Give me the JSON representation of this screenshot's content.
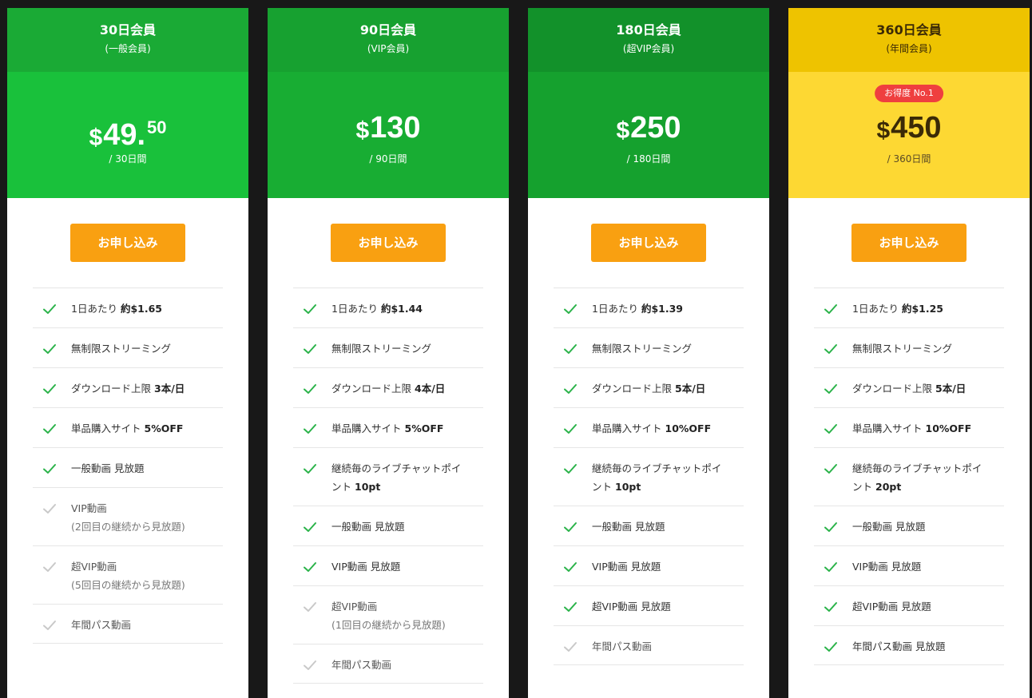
{
  "plans": [
    {
      "name": "30日会員",
      "subtitle": "(一般会員)",
      "price": {
        "currency": "$",
        "amount": "49.",
        "decimal": "50"
      },
      "period": "/ 30日間",
      "button": "お申し込み",
      "head_color": "#1aaa35",
      "price_color": "#19c13b",
      "features": [
        {
          "text": "1日あたり",
          "bold": "約$1.65",
          "included": true
        },
        {
          "text": "無制限ストリーミング",
          "included": true
        },
        {
          "text": "ダウンロード上限",
          "bold": "3本/日",
          "included": true
        },
        {
          "text": "単品購入サイト",
          "bold": "5%OFF",
          "included": true
        },
        {
          "text": "一般動画 見放題",
          "included": true
        },
        {
          "text": "VIP動画",
          "note": "(2回目の継続から見放題)",
          "included": false
        },
        {
          "text": "超VIP動画",
          "note": "(5回目の継続から見放題)",
          "included": false
        },
        {
          "text": "年間パス動画",
          "included": false
        }
      ]
    },
    {
      "name": "90日会員",
      "subtitle": "(VIP会員)",
      "price": {
        "currency": "$",
        "amount": "130"
      },
      "period": "/ 90日間",
      "button": "お申し込み",
      "head_color": "#17a130",
      "price_color": "#18ad33",
      "features": [
        {
          "text": "1日あたり",
          "bold": "約$1.44",
          "included": true
        },
        {
          "text": "無制限ストリーミング",
          "included": true
        },
        {
          "text": "ダウンロード上限",
          "bold": "4本/日",
          "included": true
        },
        {
          "text": "単品購入サイト",
          "bold": "5%OFF",
          "included": true
        },
        {
          "text": "継続毎のライブチャットポイ",
          "text2": "ント",
          "bold": "10pt",
          "included": true
        },
        {
          "text": "一般動画 見放題",
          "included": true
        },
        {
          "text": "VIP動画 見放題",
          "included": true
        },
        {
          "text": "超VIP動画",
          "note": "(1回目の継続から見放題)",
          "included": false
        },
        {
          "text": "年間パス動画",
          "included": false
        }
      ]
    },
    {
      "name": "180日会員",
      "subtitle": "(超VIP会員)",
      "price": {
        "currency": "$",
        "amount": "250"
      },
      "period": "/ 180日間",
      "button": "お申し込み",
      "head_color": "#12912a",
      "price_color": "#15a12e",
      "features": [
        {
          "text": "1日あたり",
          "bold": "約$1.39",
          "included": true
        },
        {
          "text": "無制限ストリーミング",
          "included": true
        },
        {
          "text": "ダウンロード上限",
          "bold": "5本/日",
          "included": true
        },
        {
          "text": "単品購入サイト",
          "bold": "10%OFF",
          "included": true
        },
        {
          "text": "継続毎のライブチャットポイ",
          "text2": "ント",
          "bold": "10pt",
          "included": true
        },
        {
          "text": "一般動画 見放題",
          "included": true
        },
        {
          "text": "VIP動画 見放題",
          "included": true
        },
        {
          "text": "超VIP動画 見放題",
          "included": true
        },
        {
          "text": "年間パス動画",
          "included": false
        }
      ]
    },
    {
      "name": "360日会員",
      "subtitle": "(年間会員)",
      "badge": "お得度 No.1",
      "price": {
        "currency": "$",
        "amount": "450"
      },
      "period": "/ 360日間",
      "button": "お申し込み",
      "head_color": "#eec300",
      "price_color": "#fdd833",
      "features": [
        {
          "text": "1日あたり",
          "bold": "約$1.25",
          "included": true
        },
        {
          "text": "無制限ストリーミング",
          "included": true
        },
        {
          "text": "ダウンロード上限",
          "bold": "5本/日",
          "included": true
        },
        {
          "text": "単品購入サイト",
          "bold": "10%OFF",
          "included": true
        },
        {
          "text": "継続毎のライブチャットポイ",
          "text2": "ント",
          "bold": "20pt",
          "included": true
        },
        {
          "text": "一般動画 見放題",
          "included": true
        },
        {
          "text": "VIP動画 見放題",
          "included": true
        },
        {
          "text": "超VIP動画 見放題",
          "included": true
        },
        {
          "text": "年間パス動画 見放題",
          "included": true
        }
      ]
    }
  ],
  "icons": {
    "included": "check-icon",
    "excluded": "check-icon-muted"
  },
  "colors": {
    "check_on": "#2bb34a",
    "check_off": "#c9c9c9",
    "button": "#f9a011",
    "badge": "#ef3f3f",
    "background": "#181818"
  }
}
